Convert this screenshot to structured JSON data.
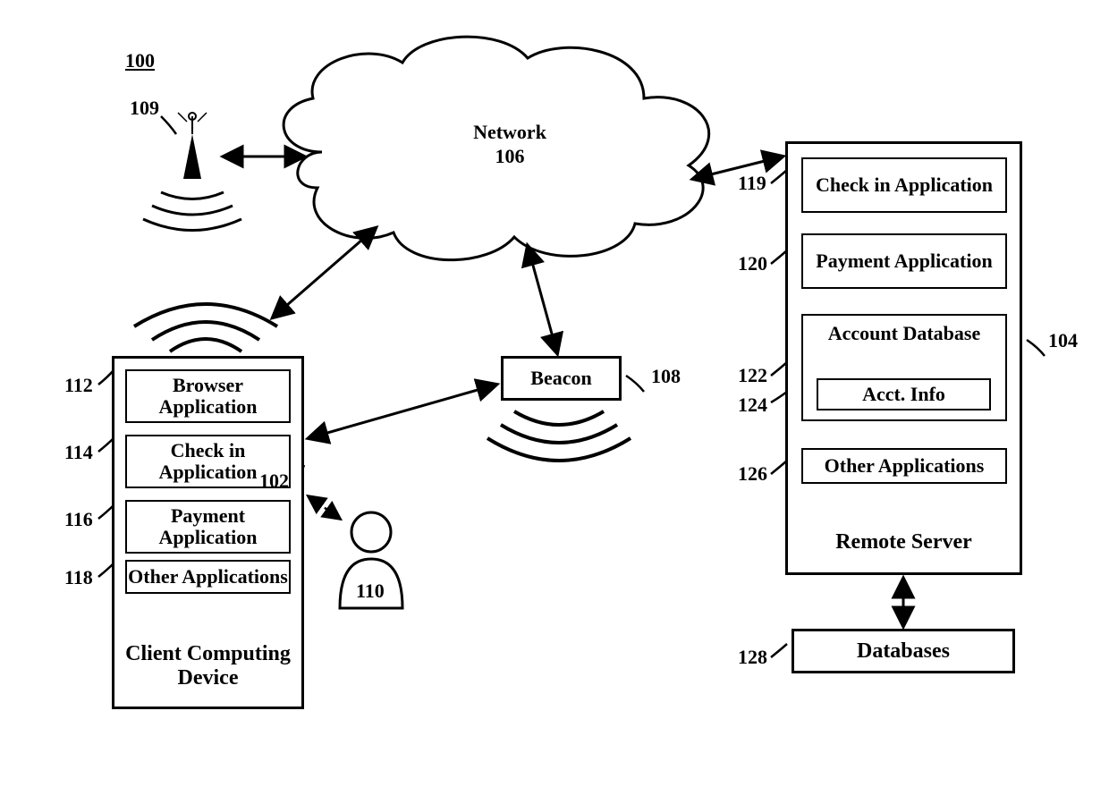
{
  "figure_ref": "100",
  "network": {
    "name": "Network",
    "ref": "106"
  },
  "antenna": {
    "ref": "109"
  },
  "beacon": {
    "name": "Beacon",
    "ref": "108"
  },
  "client": {
    "title": "Client Computing Device",
    "ref": "102",
    "user_ref": "110",
    "items": [
      {
        "label": "Browser Application",
        "ref": "112"
      },
      {
        "label": "Check in Application",
        "ref": "114"
      },
      {
        "label": "Payment Application",
        "ref": "116"
      },
      {
        "label": "Other Applications",
        "ref": "118"
      }
    ]
  },
  "server": {
    "title": "Remote Server",
    "ref": "104",
    "items": [
      {
        "label": "Check in Application",
        "ref": "119"
      },
      {
        "label": "Payment Application",
        "ref": "120"
      },
      {
        "label": "Account Database",
        "ref": "122",
        "sub": {
          "label": "Acct. Info",
          "ref": "124"
        }
      },
      {
        "label": "Other Applications",
        "ref": "126"
      }
    ]
  },
  "databases": {
    "name": "Databases",
    "ref": "128"
  }
}
